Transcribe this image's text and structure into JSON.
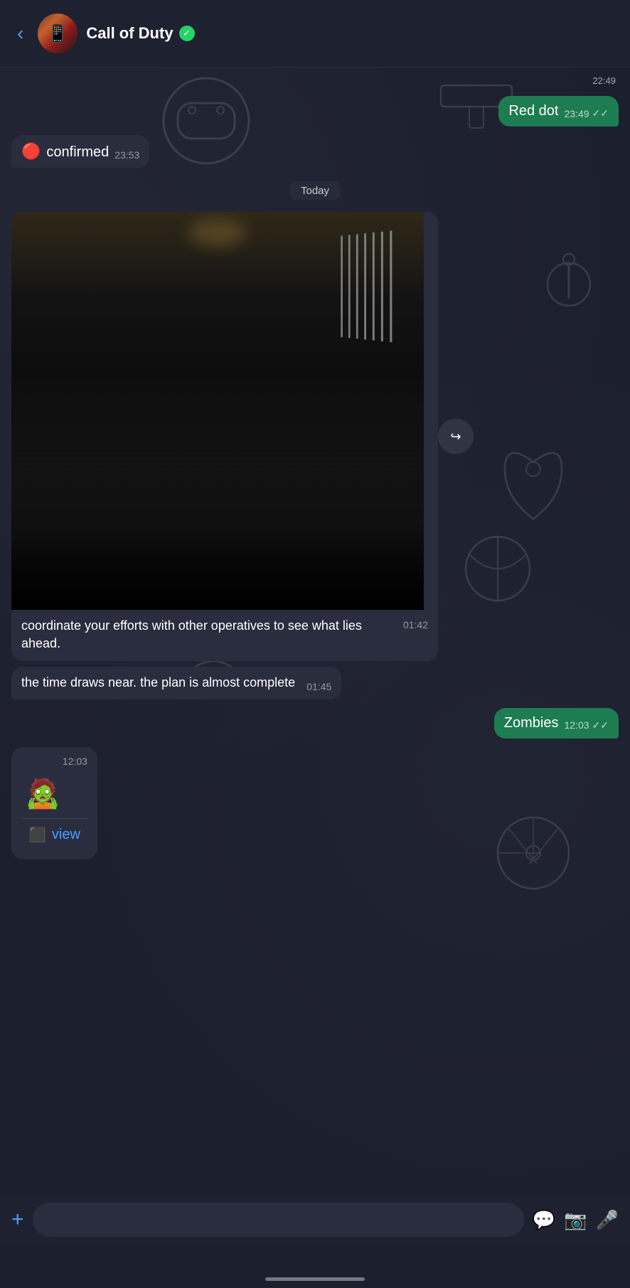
{
  "header": {
    "back_label": "‹",
    "title": "Call of Duty",
    "verified_icon": "✓",
    "avatar_emoji": "📱"
  },
  "messages": [
    {
      "id": "msg-old-timestamp",
      "type": "old-time",
      "time": "22:49"
    },
    {
      "id": "msg-red-dot",
      "type": "outgoing",
      "text": "Red dot",
      "time": "23:49",
      "ticks": "✓✓"
    },
    {
      "id": "msg-confirmed",
      "type": "incoming",
      "emoji": "🔴",
      "text": "confirmed",
      "time": "23:53"
    },
    {
      "id": "date-divider",
      "type": "date",
      "label": "Today"
    },
    {
      "id": "msg-image-caption",
      "type": "image-msg",
      "caption": "coordinate your efforts with other operatives to see what lies ahead.",
      "time": "01:42"
    },
    {
      "id": "msg-plan",
      "type": "incoming-text",
      "text": "the time draws near. the plan is almost complete",
      "time": "01:45"
    },
    {
      "id": "msg-zombies",
      "type": "outgoing",
      "text": "Zombies",
      "time": "12:03",
      "ticks": "✓✓"
    },
    {
      "id": "msg-sticker",
      "type": "sticker",
      "time": "12:03",
      "view_label": "view"
    }
  ],
  "input": {
    "placeholder": "",
    "plus_icon": "+",
    "emoji_icon": "💬",
    "camera_icon": "📷",
    "mic_icon": "🎤"
  }
}
